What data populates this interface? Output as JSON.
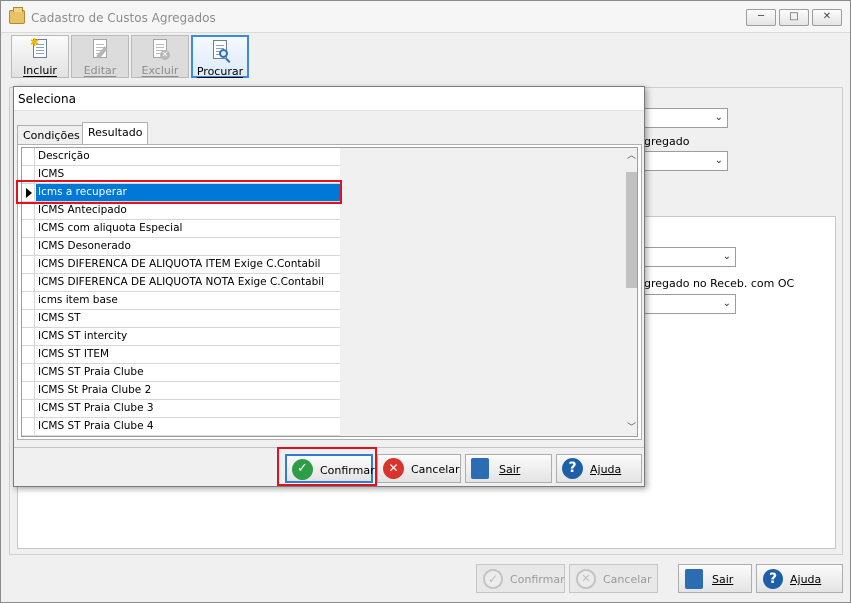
{
  "window": {
    "title": "Cadastro de Custos Agregados",
    "controls": {
      "minimize": "─",
      "maximize": "□",
      "close": "✕"
    }
  },
  "toolbar": {
    "buttons": [
      {
        "label": "Incluir",
        "icon": "new-document-icon",
        "enabled": true
      },
      {
        "label": "Editar",
        "icon": "edit-document-icon",
        "enabled": false
      },
      {
        "label": "Excluir",
        "icon": "delete-document-icon",
        "enabled": false
      },
      {
        "label": "Procurar",
        "icon": "search-document-icon",
        "enabled": true,
        "active": true
      }
    ]
  },
  "background_form": {
    "label_agregado": "gregado",
    "label_receb": "gregado no Receb. com OC"
  },
  "dialog": {
    "title": "Seleciona",
    "tabs": [
      {
        "label": "Condições",
        "selected": false
      },
      {
        "label": "Resultado",
        "selected": true
      }
    ],
    "grid": {
      "header": "Descrição",
      "rows": [
        "ICMS",
        "Icms a recuperar",
        "ICMS Antecipado",
        "ICMS com aliquota Especial",
        "ICMS Desonerado",
        "ICMS DIFERENCA DE ALIQUOTA ITEM Exige C.Contabil",
        "ICMS DIFERENCA DE ALIQUOTA NOTA Exige C.Contabil",
        "icms item base",
        "ICMS ST",
        "ICMS ST intercity",
        "ICMS ST ITEM",
        "ICMS ST Praia Clube",
        "ICMS St Praia Clube 2",
        "ICMS ST Praia Clube 3",
        "ICMS ST Praia Clube 4"
      ],
      "selected_index": 1
    },
    "buttons": {
      "confirm": "Confirmar",
      "cancel": "Cancelar",
      "exit": "Sair",
      "help": "Ajuda"
    }
  },
  "main_buttons": {
    "confirm": "Confirmar",
    "cancel": "Cancelar",
    "exit": "Sair",
    "help": "Ajuda"
  },
  "colors": {
    "selection": "#0078d7",
    "highlight_box": "#e0121e",
    "confirm_green": "#2e9e46",
    "cancel_red": "#d9342b",
    "help_blue": "#1f5fa8"
  }
}
